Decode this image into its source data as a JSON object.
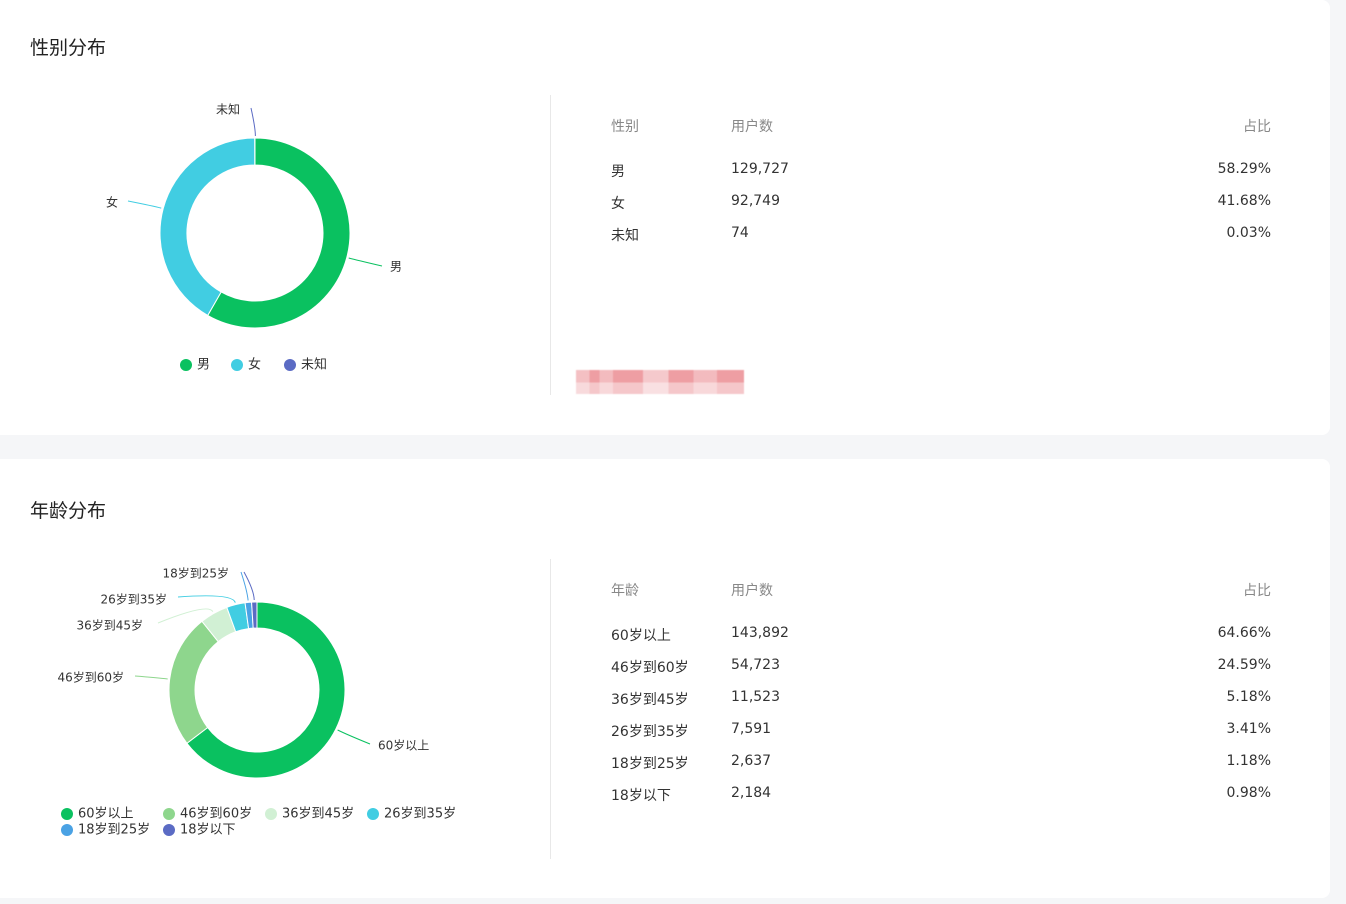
{
  "gender_section": {
    "title": "性别分布",
    "table": {
      "headers": [
        "性别",
        "用户数",
        "占比"
      ],
      "rows": [
        [
          "男",
          "129,727",
          "58.29%"
        ],
        [
          "女",
          "92,749",
          "41.68%"
        ],
        [
          "未知",
          "74",
          "0.03%"
        ]
      ]
    }
  },
  "age_section": {
    "title": "年龄分布",
    "table": {
      "headers": [
        "年龄",
        "用户数",
        "占比"
      ],
      "rows": [
        [
          "60岁以上",
          "143,892",
          "64.66%"
        ],
        [
          "46岁到60岁",
          "54,723",
          "24.59%"
        ],
        [
          "36岁到45岁",
          "11,523",
          "5.18%"
        ],
        [
          "26岁到35岁",
          "7,591",
          "3.41%"
        ],
        [
          "18岁到25岁",
          "2,637",
          "1.18%"
        ],
        [
          "18岁以下",
          "2,184",
          "0.98%"
        ]
      ]
    }
  },
  "chart_data": [
    {
      "type": "pie",
      "categories": [
        "男",
        "女",
        "未知"
      ],
      "values": [
        129727,
        92749,
        74
      ],
      "colors": [
        "#0ac160",
        "#41cde2",
        "#5b6bc4"
      ],
      "legend": "bottom"
    },
    {
      "type": "pie",
      "categories": [
        "60岁以上",
        "46岁到60岁",
        "36岁到45岁",
        "26岁到35岁",
        "18岁到25岁",
        "18岁以下"
      ],
      "values": [
        143892,
        54723,
        11523,
        7591,
        2637,
        2184
      ],
      "colors": [
        "#0ac160",
        "#8ed68d",
        "#d1f0d4",
        "#41cde2",
        "#4aa2e4",
        "#5b6bc4"
      ],
      "legend": "bottom"
    }
  ]
}
